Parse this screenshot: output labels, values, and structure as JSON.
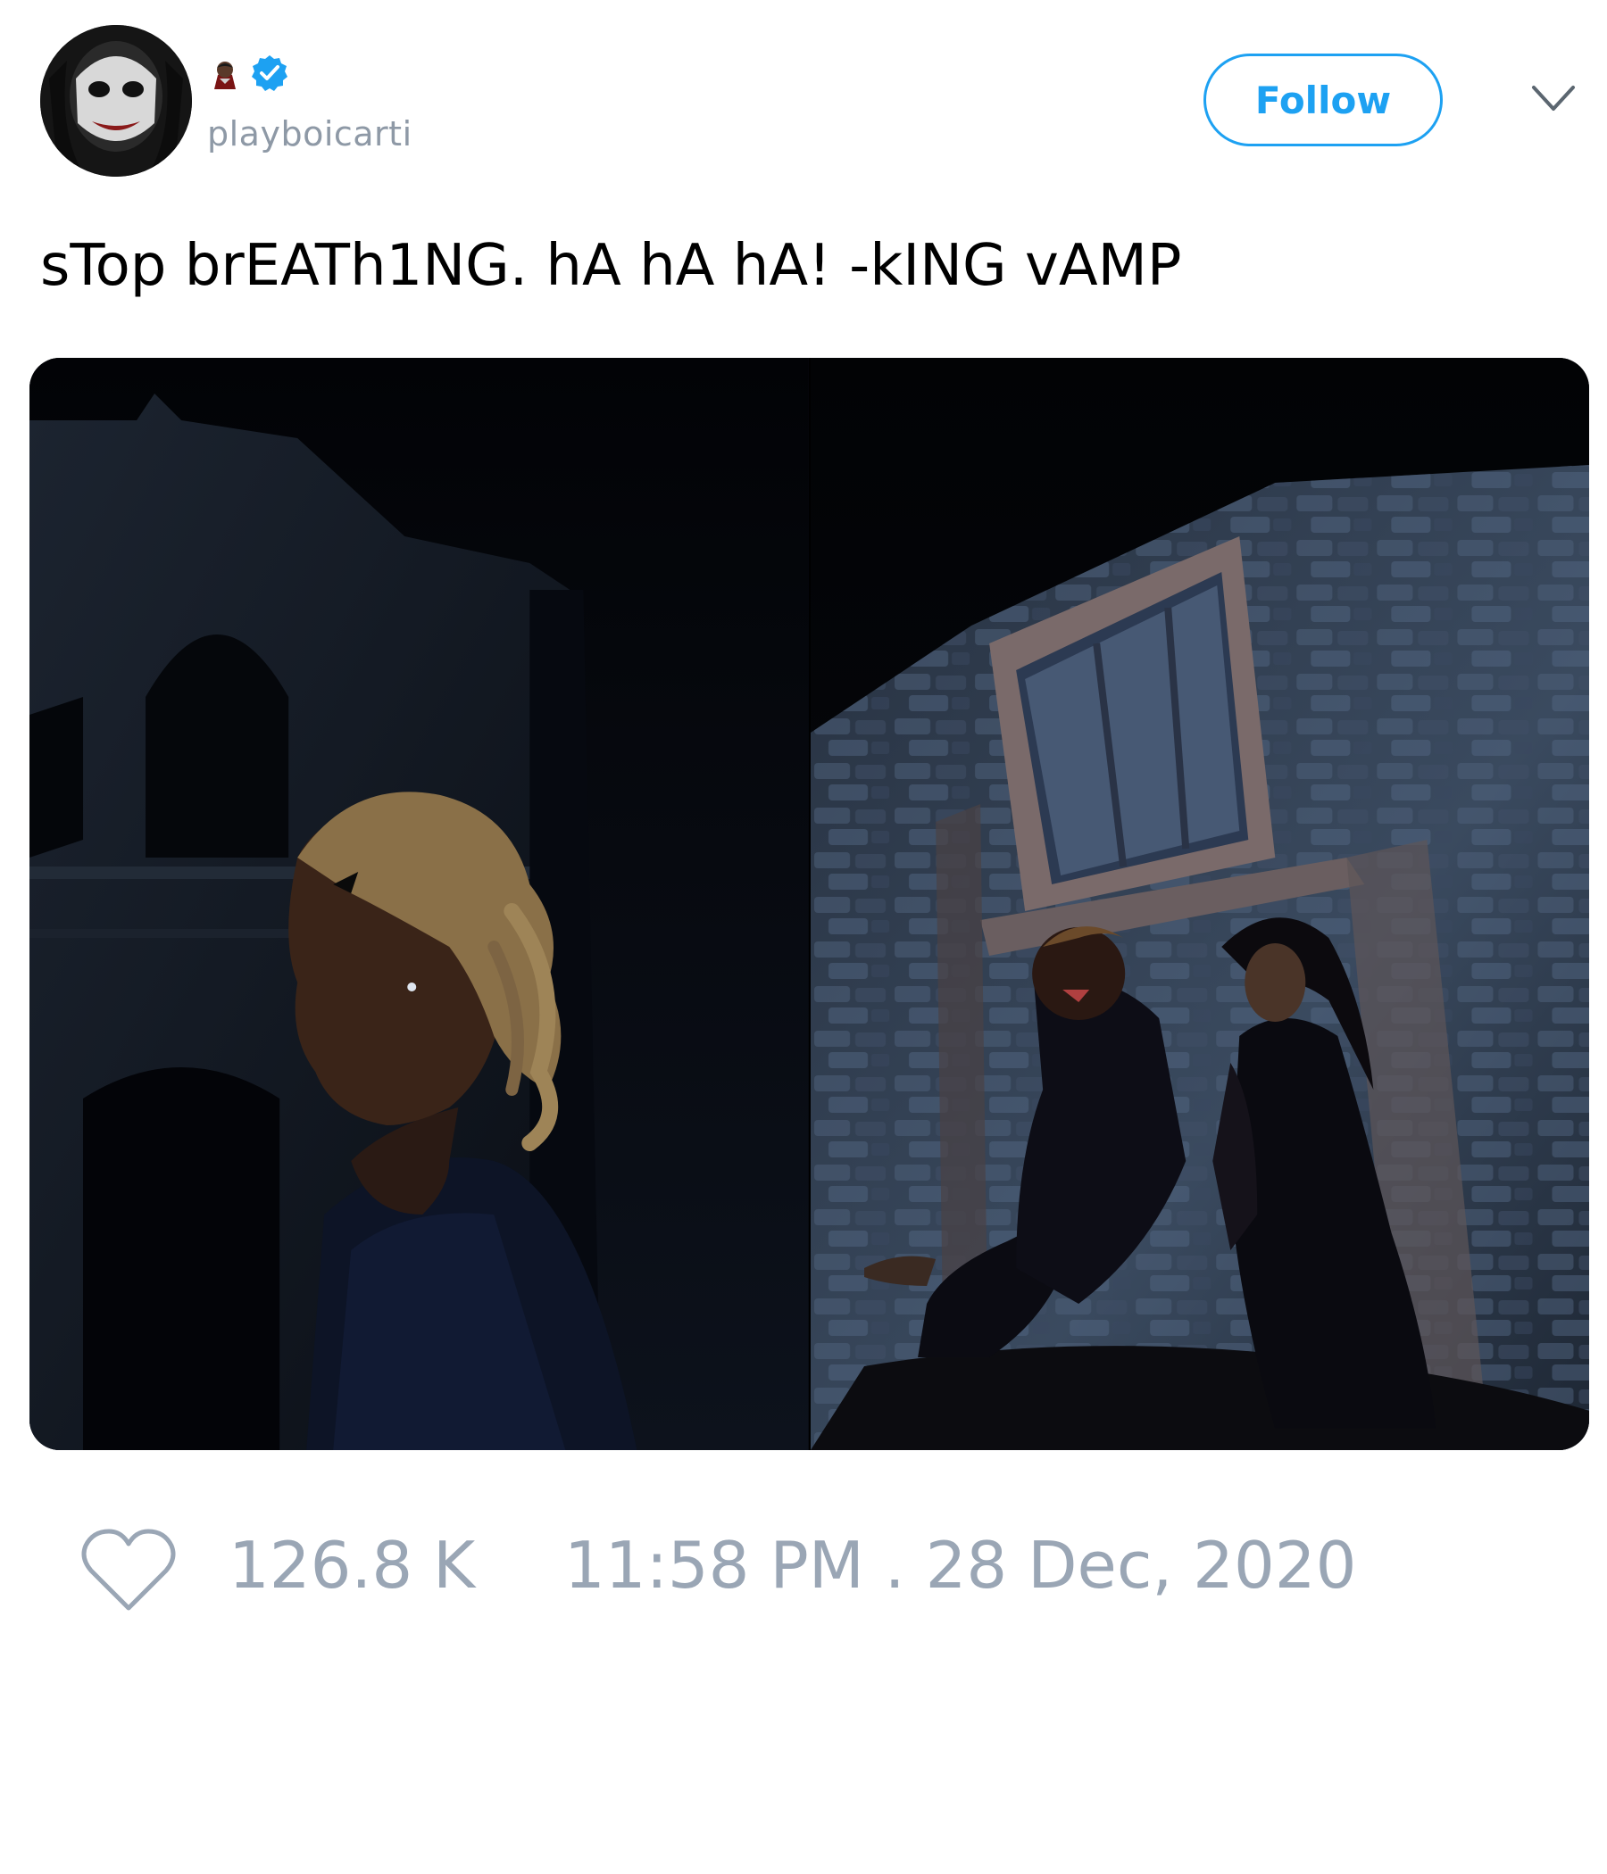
{
  "user": {
    "display_emoji": "vampire-emoji",
    "verified": true,
    "handle": "playboicarti",
    "avatar_icon": "joker-face-avatar"
  },
  "actions": {
    "follow_label": "Follow",
    "menu_icon": "chevron-down-icon"
  },
  "tweet": {
    "text": "sTop brEATh1NG. hA hA hA! -kING vAMP",
    "media": [
      {
        "description_icon": "photo-left"
      },
      {
        "description_icon": "photo-right"
      }
    ]
  },
  "footer": {
    "like_icon": "heart-icon",
    "likes": "126.8 K",
    "timestamp": "11:58 PM . 28 Dec, 2020"
  },
  "colors": {
    "accent": "#1da1f2",
    "muted": "#9aa6b5",
    "text": "#000000"
  }
}
